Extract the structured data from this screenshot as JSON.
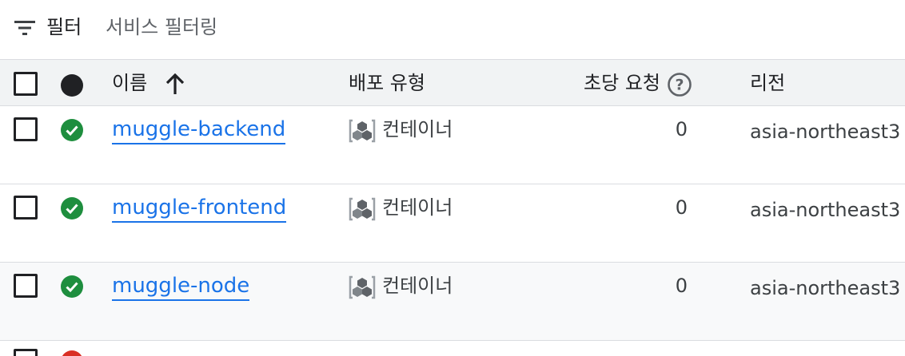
{
  "filter": {
    "label": "필터",
    "placeholder": "서비스 필터링"
  },
  "table": {
    "columns": {
      "name": "이름",
      "deploy_type": "배포 유형",
      "requests": "초당 요청",
      "region": "리전"
    },
    "rows": [
      {
        "name": "muggle-backend",
        "deploy_type": "컨테이너",
        "requests": "0",
        "region": "asia-northeast3",
        "status": "ok"
      },
      {
        "name": "muggle-frontend",
        "deploy_type": "컨테이너",
        "requests": "0",
        "region": "asia-northeast3",
        "status": "ok"
      },
      {
        "name": "muggle-node",
        "deploy_type": "컨테이너",
        "requests": "0",
        "region": "asia-northeast3",
        "status": "ok"
      }
    ]
  },
  "colors": {
    "link": "#1a73e8",
    "status_ok": "#1e8e3e",
    "status_error": "#d93025",
    "header_bg": "#f1f3f4"
  },
  "icons": [
    "filter-list-icon",
    "arrow-upward-icon",
    "help-circle-icon",
    "check-circle-icon",
    "container-icon"
  ]
}
